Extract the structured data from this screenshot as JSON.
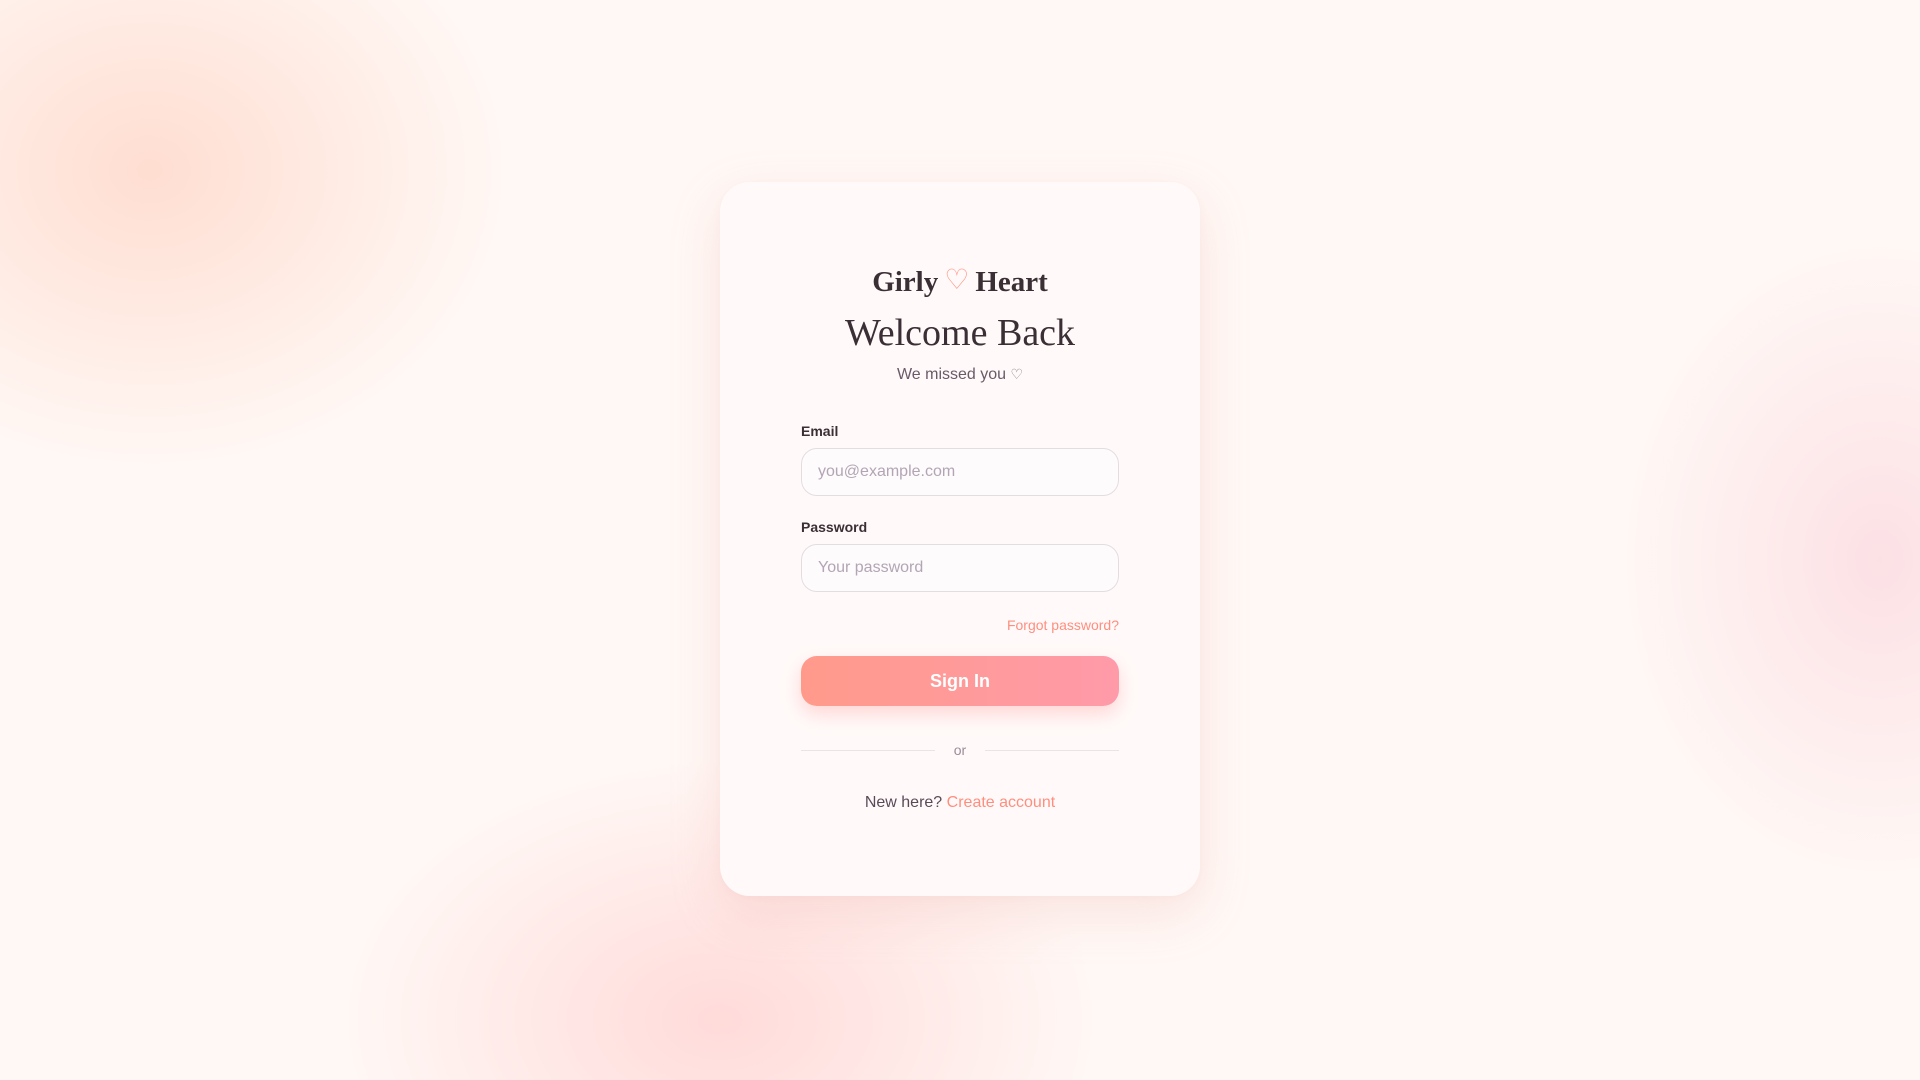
{
  "brand": {
    "name_left": "Girly",
    "heart_glyph": "♡",
    "name_right": "Heart"
  },
  "login": {
    "title": "Welcome Back",
    "subtitle": "We missed you",
    "subtitle_heart": "♡",
    "email_label": "Email",
    "email_placeholder": "you@example.com",
    "email_value": "",
    "password_label": "Password",
    "password_placeholder": "Your password",
    "password_value": "",
    "forgot_link": "Forgot password?",
    "signin_button": "Sign In",
    "divider_text": "or",
    "signup_prompt": "New here?",
    "signup_link": "Create account"
  },
  "icons": {
    "brand_heart": "heart-outline-icon",
    "subtitle_heart": "heart-outline-icon"
  },
  "colors": {
    "accent": "#ff9a8b",
    "accent_end": "#ff9aa9",
    "text_dark": "#3a2f35",
    "background": "#fff8f5"
  }
}
